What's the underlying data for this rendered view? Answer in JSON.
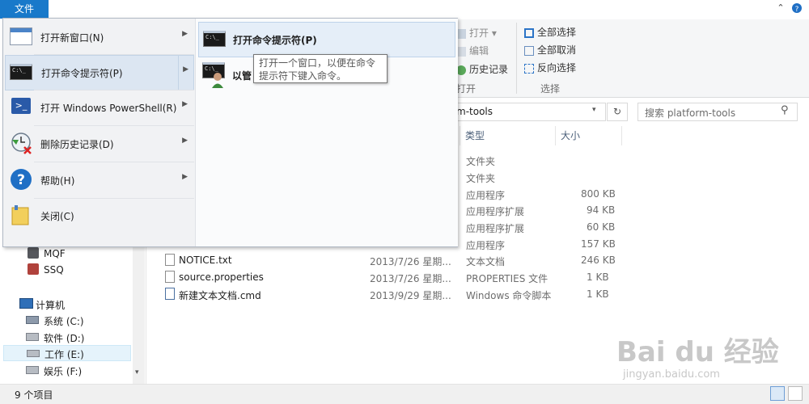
{
  "file_tab": "文件",
  "menu": {
    "items": [
      {
        "label": "打开新窗口(N)",
        "icon": "new-window-icon"
      },
      {
        "label": "打开命令提示符(P)",
        "icon": "cmd-icon"
      },
      {
        "label": "打开 Windows PowerShell(R)",
        "icon": "powershell-icon"
      },
      {
        "label": "删除历史记录(D)",
        "icon": "delete-history-icon"
      },
      {
        "label": "帮助(H)",
        "icon": "help-icon"
      },
      {
        "label": "关闭(C)",
        "icon": "close-folder-icon"
      }
    ],
    "submenu": [
      {
        "label": "打开命令提示符(P)"
      },
      {
        "label": "以管"
      }
    ],
    "tooltip_line1": "打开一个窗口，以便在命令",
    "tooltip_line2": "提示符下键入命令。"
  },
  "ribbon": {
    "open": "打开",
    "edit": "编辑",
    "history": "历史记录",
    "open_group": "打开",
    "select_all": "全部选择",
    "select_none": "全部取消",
    "invert": "反向选择",
    "select_group": "选择"
  },
  "address": {
    "path_tail": "m-tools",
    "search_placeholder": "搜索 platform-tools"
  },
  "columns": {
    "type": "类型",
    "size": "大小"
  },
  "rows_partial": [
    {
      "type": "文件夹",
      "size": ""
    },
    {
      "type": "文件夹",
      "size": ""
    },
    {
      "type": "应用程序",
      "size": "800 KB"
    },
    {
      "type": "应用程序扩展",
      "size": "94 KB"
    },
    {
      "type": "应用程序扩展",
      "size": "60 KB"
    },
    {
      "type": "应用程序",
      "size": "157 KB"
    }
  ],
  "rows": [
    {
      "name": "NOTICE.txt",
      "date": "2013/7/26 星期...",
      "type": "文本文档",
      "size": "246 KB"
    },
    {
      "name": "source.properties",
      "date": "2013/7/26 星期...",
      "type": "PROPERTIES 文件",
      "size": "1 KB"
    },
    {
      "name": "新建文本文档.cmd",
      "date": "2013/9/29 星期...",
      "type": "Windows 命令脚本",
      "size": "1 KB"
    }
  ],
  "nav": {
    "users": [
      "MQF",
      "SSQ"
    ],
    "computer": "计算机",
    "drives": [
      "系统 (C:)",
      "软件 (D:)",
      "工作 (E:)",
      "娱乐 (F:)"
    ]
  },
  "status": {
    "count": "9 个项目"
  },
  "watermark": {
    "logo": "Bai du 经验",
    "url": "jingyan.baidu.com"
  }
}
